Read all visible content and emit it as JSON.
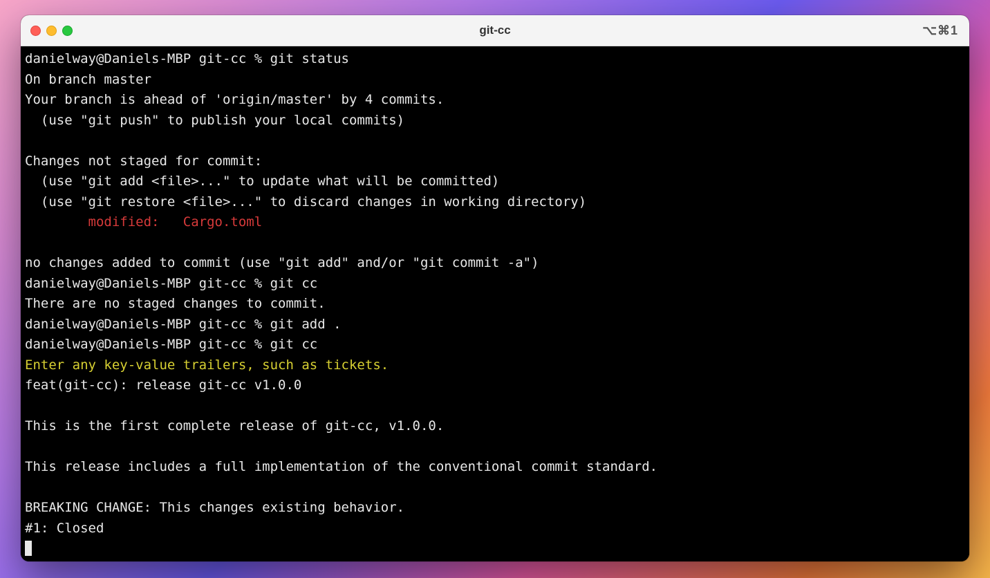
{
  "window": {
    "title": "git-cc",
    "tab_hint": "⌥⌘1"
  },
  "prompt": "danielway@Daniels-MBP git-cc % ",
  "lines": [
    {
      "segs": [
        {
          "t": "danielway@Daniels-MBP git-cc % "
        },
        {
          "t": "git status"
        }
      ]
    },
    {
      "segs": [
        {
          "t": "On branch master"
        }
      ]
    },
    {
      "segs": [
        {
          "t": "Your branch is ahead of 'origin/master' by 4 commits."
        }
      ]
    },
    {
      "segs": [
        {
          "t": "  (use \"git push\" to publish your local commits)"
        }
      ]
    },
    {
      "segs": [
        {
          "t": ""
        }
      ]
    },
    {
      "segs": [
        {
          "t": "Changes not staged for commit:"
        }
      ]
    },
    {
      "segs": [
        {
          "t": "  (use \"git add <file>...\" to update what will be committed)"
        }
      ]
    },
    {
      "segs": [
        {
          "t": "  (use \"git restore <file>...\" to discard changes in working directory)"
        }
      ]
    },
    {
      "segs": [
        {
          "t": "        "
        },
        {
          "t": "modified:   Cargo.toml",
          "cls": "red"
        }
      ]
    },
    {
      "segs": [
        {
          "t": ""
        }
      ]
    },
    {
      "segs": [
        {
          "t": "no changes added to commit (use \"git add\" and/or \"git commit -a\")"
        }
      ]
    },
    {
      "segs": [
        {
          "t": "danielway@Daniels-MBP git-cc % "
        },
        {
          "t": "git cc"
        }
      ]
    },
    {
      "segs": [
        {
          "t": "There are no staged changes to commit."
        }
      ]
    },
    {
      "segs": [
        {
          "t": "danielway@Daniels-MBP git-cc % "
        },
        {
          "t": "git add ."
        }
      ]
    },
    {
      "segs": [
        {
          "t": "danielway@Daniels-MBP git-cc % "
        },
        {
          "t": "git cc"
        }
      ]
    },
    {
      "segs": [
        {
          "t": "Enter any key-value trailers, such as tickets.",
          "cls": "yellow"
        }
      ]
    },
    {
      "segs": [
        {
          "t": "feat(git-cc): release git-cc v1.0.0"
        }
      ]
    },
    {
      "segs": [
        {
          "t": ""
        }
      ]
    },
    {
      "segs": [
        {
          "t": "This is the first complete release of git-cc, v1.0.0."
        }
      ]
    },
    {
      "segs": [
        {
          "t": ""
        }
      ]
    },
    {
      "segs": [
        {
          "t": "This release includes a full implementation of the conventional commit standard."
        }
      ]
    },
    {
      "segs": [
        {
          "t": ""
        }
      ]
    },
    {
      "segs": [
        {
          "t": "BREAKING CHANGE: This changes existing behavior."
        }
      ]
    },
    {
      "segs": [
        {
          "t": "#1: Closed"
        }
      ]
    }
  ]
}
